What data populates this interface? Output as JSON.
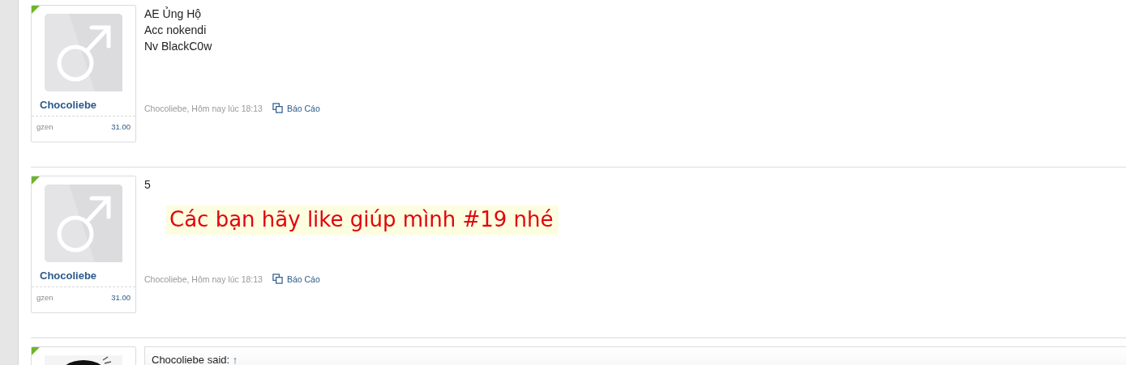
{
  "posts": [
    {
      "kind": "message",
      "user": {
        "name": "Chocoliebe",
        "avatar": {
          "kind": "male"
        },
        "title": "gzen",
        "score": "31.00"
      },
      "lines": [
        "AE Ủng Hộ",
        "Acc nokendi",
        "Nv BlackC0w"
      ],
      "meta": {
        "byline": "Chocoliebe, Hôm nay lúc 18:13",
        "report": "Báo Cáo"
      }
    },
    {
      "kind": "message",
      "user": {
        "name": "Chocoliebe",
        "avatar": {
          "kind": "male"
        },
        "title": "gzen",
        "score": "31.00"
      },
      "lines": [
        "5"
      ],
      "highlight": "Các bạn hãy like giúp mình #19 nhé",
      "meta": {
        "byline": "Chocoliebe, Hôm nay lúc 18:13",
        "report": "Báo Cáo"
      }
    },
    {
      "kind": "quote",
      "quote": {
        "author": "Chocoliebe said:",
        "arrow": "↑"
      }
    }
  ]
}
